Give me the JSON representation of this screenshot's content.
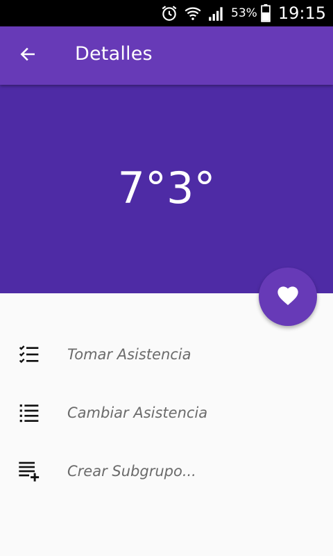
{
  "status_bar": {
    "battery_percent": "53%",
    "time": "19:15",
    "icons": [
      "alarm-icon",
      "wifi-icon",
      "signal-icon",
      "battery-icon"
    ]
  },
  "app_bar": {
    "title": "Detalles",
    "back_icon": "arrow-back-icon"
  },
  "hero": {
    "temperature": "7°3°",
    "background_color": "#4e2ba5"
  },
  "fab": {
    "icon": "heart-icon",
    "color": "#673ab7"
  },
  "menu": {
    "items": [
      {
        "label": "Tomar Asistencia",
        "icon": "checklist-icon"
      },
      {
        "label": "Cambiar Asistencia",
        "icon": "list-icon"
      },
      {
        "label": "Crear Subgrupo...",
        "icon": "playlist-add-icon"
      }
    ]
  },
  "colors": {
    "primary": "#673ab7",
    "primary_dark": "#4e2ba5",
    "background": "#fafafa"
  }
}
